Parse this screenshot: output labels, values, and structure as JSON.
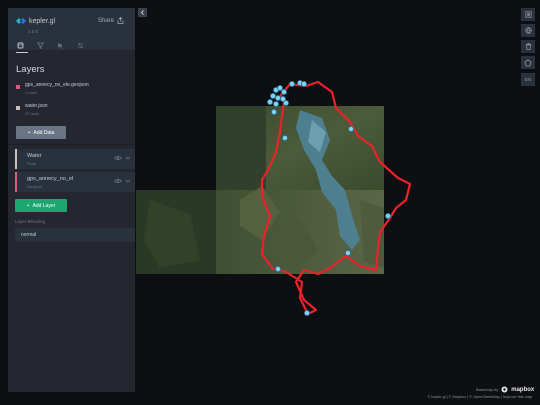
{
  "app": {
    "name": "kepler.gl",
    "version": "2.5.5",
    "share_label": "Share"
  },
  "side_panel": {
    "tabs": [
      "layers-icon",
      "filter-icon",
      "interactions-icon",
      "map-settings-icon"
    ],
    "section_title": "Layers",
    "datasets": [
      {
        "name": "gps_annecy_no_ele.geojson",
        "rows": "1 rows",
        "color": "#e05a7e"
      },
      {
        "name": "water.json",
        "rows": "47 rows",
        "color": "#c7c2b8"
      }
    ],
    "add_data_label": "Add Data",
    "layers": [
      {
        "name": "Water",
        "type": "Point",
        "color": "#c7c2b8"
      },
      {
        "name": "gps_annecy_no_el",
        "type": "Geojson",
        "color": "#e05a7e"
      }
    ],
    "add_layer_label": "Add Layer",
    "blending_label": "Layer Blending",
    "blending_value": "normal"
  },
  "map_controls": [
    "layer-visibility-icon",
    "globe-icon",
    "delete-icon",
    "draw-polygon-icon",
    "locale-en"
  ],
  "locale_label": "EN",
  "attribution": {
    "powered_by": "Basemap by",
    "provider": "mapbox",
    "text": "© kepler.gl | © Mapbox | © OpenStreetMap | Improve this map"
  },
  "colors": {
    "route": "#e8232b",
    "points": "#7fd3f2"
  }
}
